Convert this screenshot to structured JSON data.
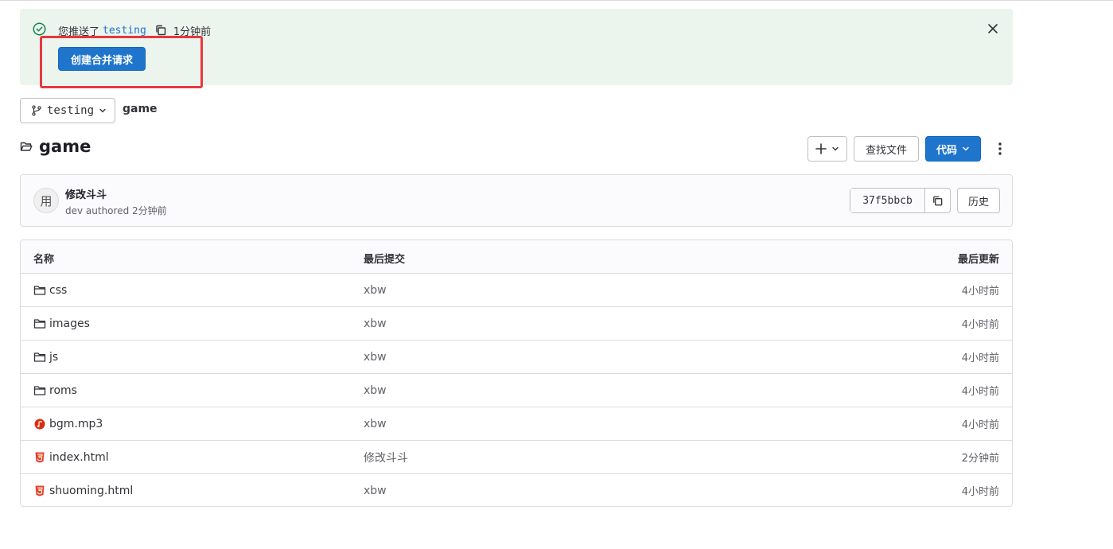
{
  "alert": {
    "prefix": "您推送了",
    "branch": "testing",
    "time": "1分钟前",
    "button_label": "创建合并请求"
  },
  "branch_selector": {
    "name": "testing"
  },
  "breadcrumb": {
    "path": "game"
  },
  "title": {
    "text": "game"
  },
  "toolbar": {
    "find_file_label": "查找文件",
    "code_label": "代码"
  },
  "last_commit": {
    "avatar_text": "用",
    "title": "修改斗斗",
    "meta": "dev authored 2分钟前",
    "sha": "37f5bbcb",
    "history_label": "历史"
  },
  "table": {
    "headers": {
      "name": "名称",
      "last_commit": "最后提交",
      "last_update": "最后更新"
    },
    "rows": [
      {
        "icon": "folder-icon",
        "name": "css",
        "commit": "xbw",
        "updated": "4小时前"
      },
      {
        "icon": "folder-icon",
        "name": "images",
        "commit": "xbw",
        "updated": "4小时前"
      },
      {
        "icon": "folder-icon",
        "name": "js",
        "commit": "xbw",
        "updated": "4小时前"
      },
      {
        "icon": "folder-icon",
        "name": "roms",
        "commit": "xbw",
        "updated": "4小时前"
      },
      {
        "icon": "audio-file-icon",
        "name": "bgm.mp3",
        "commit": "xbw",
        "updated": "4小时前"
      },
      {
        "icon": "html5-icon",
        "name": "index.html",
        "commit": "修改斗斗",
        "updated": "2分钟前"
      },
      {
        "icon": "html5-icon",
        "name": "shuoming.html",
        "commit": "xbw",
        "updated": "4小时前"
      }
    ]
  },
  "colors": {
    "alert_bg": "#ecf4ee",
    "primary": "#1f75cb",
    "success": "#108548",
    "highlight": "#e8383d",
    "html_icon": "#e24329",
    "audio_icon": "#dd2b0e"
  }
}
